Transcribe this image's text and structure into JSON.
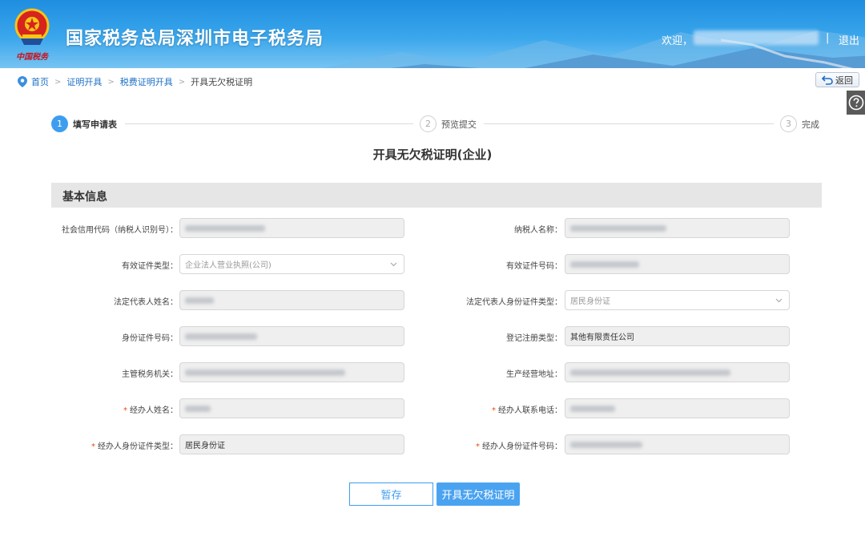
{
  "header": {
    "site_title": "国家税务总局深圳市电子税务局",
    "slogan": "中国税务",
    "welcome": "欢迎，",
    "separator": "|",
    "logout": "退出"
  },
  "breadcrumb": {
    "home": "首页",
    "items": [
      "证明开具",
      "税费证明开具"
    ],
    "current": "开具无欠税证明",
    "arrow": ">"
  },
  "back_label": "返回",
  "steps": [
    {
      "num": "1",
      "label": "填写申请表",
      "state": "active"
    },
    {
      "num": "2",
      "label": "预览提交",
      "state": "todo"
    },
    {
      "num": "3",
      "label": "完成",
      "state": "todo"
    }
  ],
  "page_title": "开具无欠税证明(企业)",
  "section_title": "基本信息",
  "form": {
    "left": [
      {
        "label": "社会信用代码（纳税人识别号）：",
        "value": "",
        "type": "text",
        "required": false
      },
      {
        "label": "有效证件类型：",
        "value": "企业法人营业执照(公司)",
        "type": "select",
        "required": false
      },
      {
        "label": "法定代表人姓名：",
        "value": "",
        "type": "text",
        "required": false
      },
      {
        "label": "身份证件号码：",
        "value": "",
        "type": "text",
        "required": false
      },
      {
        "label": "主管税务机关：",
        "value": "",
        "type": "text",
        "required": false
      },
      {
        "label": "经办人姓名：",
        "value": "",
        "type": "text",
        "required": true
      },
      {
        "label": "经办人身份证件类型：",
        "value": "居民身份证",
        "type": "text",
        "required": true
      }
    ],
    "right": [
      {
        "label": "纳税人名称：",
        "value": "",
        "type": "text",
        "required": false
      },
      {
        "label": "有效证件号码：",
        "value": "",
        "type": "text",
        "required": false
      },
      {
        "label": "法定代表人身份证件类型：",
        "value": "居民身份证",
        "type": "select",
        "required": false
      },
      {
        "label": "登记注册类型：",
        "value": "其他有限责任公司",
        "type": "text",
        "required": false
      },
      {
        "label": "生产经营地址：",
        "value": "",
        "type": "text",
        "required": false
      },
      {
        "label": "经办人联系电话：",
        "value": "",
        "type": "text",
        "required": true
      },
      {
        "label": "经办人身份证件号码：",
        "value": "",
        "type": "text",
        "required": true
      }
    ]
  },
  "buttons": {
    "save": "暂存",
    "submit": "开具无欠税证明"
  },
  "colors": {
    "accent": "#3d9ef0",
    "link": "#1b6fc7",
    "required": "#e84b0f",
    "header": "#1f8ee0"
  }
}
